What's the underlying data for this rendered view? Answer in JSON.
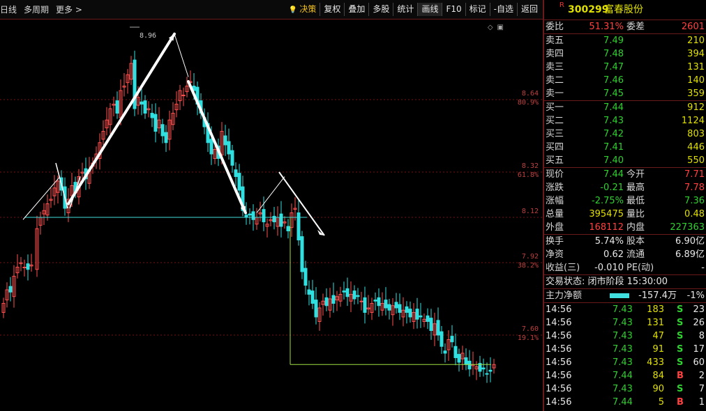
{
  "toolbar": {
    "left": [
      "日线",
      "多周期",
      "更多 >"
    ],
    "right": [
      {
        "label": "决策",
        "accent": true,
        "icon": "lightbulb-icon"
      },
      {
        "label": "复权"
      },
      {
        "label": "叠加"
      },
      {
        "label": "多股"
      },
      {
        "label": "统计"
      },
      {
        "label": "画线",
        "selected": true
      },
      {
        "label": "F10"
      },
      {
        "label": "标记"
      },
      {
        "label": "-自选"
      },
      {
        "label": "返回"
      }
    ]
  },
  "chart": {
    "peak_label": "8.96",
    "axis_labels": [
      {
        "price": "8.64",
        "pct": "80.9%",
        "value": 8.64
      },
      {
        "price": "8.32",
        "pct": "61.8%",
        "value": 8.32
      },
      {
        "price": "8.12",
        "pct": "",
        "value": 8.12
      },
      {
        "price": "7.92",
        "pct": "38.2%",
        "value": 7.92
      },
      {
        "price": "7.60",
        "pct": "19.1%",
        "value": 7.6
      }
    ],
    "colors": {
      "up": "#ff5050",
      "down": "#30e0e0",
      "grid": "#7a1010",
      "support": "#40e0e0",
      "box": "#a0e040",
      "arrow": "#ffffff"
    }
  },
  "stock": {
    "mark": "R",
    "code": "300299",
    "name": "富春股份"
  },
  "quote": {
    "weibi_label": "委比",
    "weibi": "51.31%",
    "weicha_label": "委差",
    "weicha": "2601",
    "asks": [
      {
        "label": "卖五",
        "price": "7.49",
        "vol": "210"
      },
      {
        "label": "卖四",
        "price": "7.48",
        "vol": "394"
      },
      {
        "label": "卖三",
        "price": "7.47",
        "vol": "131"
      },
      {
        "label": "卖二",
        "price": "7.46",
        "vol": "140"
      },
      {
        "label": "卖一",
        "price": "7.45",
        "vol": "359"
      }
    ],
    "bids": [
      {
        "label": "买一",
        "price": "7.44",
        "vol": "912"
      },
      {
        "label": "买二",
        "price": "7.43",
        "vol": "1124"
      },
      {
        "label": "买三",
        "price": "7.42",
        "vol": "803"
      },
      {
        "label": "买四",
        "price": "7.41",
        "vol": "446"
      },
      {
        "label": "买五",
        "price": "7.40",
        "vol": "550"
      }
    ],
    "stats": [
      {
        "l1": "现价",
        "v1": "7.44",
        "c1": "g",
        "l2": "今开",
        "v2": "7.71",
        "c2": "r"
      },
      {
        "l1": "涨跌",
        "v1": "-0.21",
        "c1": "g",
        "l2": "最高",
        "v2": "7.78",
        "c2": "r"
      },
      {
        "l1": "涨幅",
        "v1": "-2.75%",
        "c1": "g",
        "l2": "最低",
        "v2": "7.36",
        "c2": "g"
      },
      {
        "l1": "总量",
        "v1": "395475",
        "c1": "y",
        "l2": "量比",
        "v2": "0.48",
        "c2": "y"
      },
      {
        "l1": "外盘",
        "v1": "168112",
        "c1": "r",
        "l2": "内盘",
        "v2": "227363",
        "c2": "g"
      }
    ],
    "stats2": [
      {
        "l1": "换手",
        "v1": "5.74%",
        "l2": "股本",
        "v2": "6.90亿"
      },
      {
        "l1": "净资",
        "v1": "0.62",
        "l2": "流通",
        "v2": "6.89亿"
      },
      {
        "l1": "收益(三)",
        "v1": "-0.010",
        "l2": "PE(动)",
        "v2": "-"
      }
    ],
    "state_label": "交易状态: 闭市阶段 15:30:00",
    "flow_label": "主力净额",
    "flow_value": "-157.4万",
    "flow_pct": "-1%"
  },
  "ticks": [
    {
      "t": "14:56",
      "p": "7.43",
      "v": "183",
      "s": "S",
      "n": "23"
    },
    {
      "t": "14:56",
      "p": "7.43",
      "v": "131",
      "s": "S",
      "n": "26"
    },
    {
      "t": "14:56",
      "p": "7.43",
      "v": "47",
      "s": "S",
      "n": "8"
    },
    {
      "t": "14:56",
      "p": "7.43",
      "v": "91",
      "s": "S",
      "n": "17"
    },
    {
      "t": "14:56",
      "p": "7.43",
      "v": "433",
      "s": "S",
      "n": "60"
    },
    {
      "t": "14:56",
      "p": "7.44",
      "v": "84",
      "s": "B",
      "n": "2"
    },
    {
      "t": "14:56",
      "p": "7.43",
      "v": "90",
      "s": "S",
      "n": "7"
    },
    {
      "t": "14:56",
      "p": "7.44",
      "v": "5",
      "s": "B",
      "n": "1"
    }
  ]
}
